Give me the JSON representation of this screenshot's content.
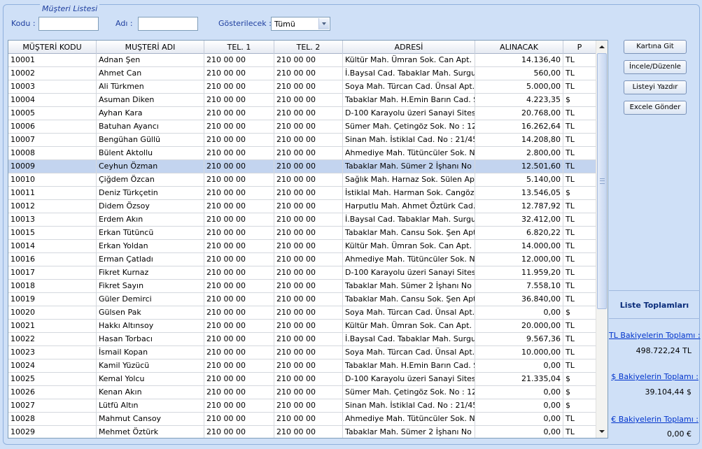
{
  "group_title": "Müşteri Listesi",
  "filters": {
    "code_label": "Kodu :",
    "code_value": "",
    "name_label": "Adı :",
    "name_value": "",
    "show_label": "Gösterilecek :",
    "show_value": "Tümü"
  },
  "columns": [
    "MÜŞTERİ KODU",
    "MUŞTERİ ADI",
    "TEL. 1",
    "TEL. 2",
    "ADRESİ",
    "ALINACAK",
    "P"
  ],
  "selected_row": 8,
  "rows": [
    [
      "10001",
      "Adnan Şen",
      "210 00 00",
      "210 00 00",
      "Kültür Mah. Ümran Sok. Can Apt. No :",
      "14.136,40",
      "TL"
    ],
    [
      "10002",
      "Ahmet Can",
      "210 00 00",
      "210 00 00",
      "İ.Baysal Cad. Tabaklar Mah. Surgulu A",
      "560,00",
      "TL"
    ],
    [
      "10003",
      "Ali Türkmen",
      "210 00 00",
      "210 00 00",
      "Soya Mah. Türcan Cad. Ünsal Apt. No",
      "5.000,00",
      "TL"
    ],
    [
      "10004",
      "Asuman Diken",
      "210 00 00",
      "210 00 00",
      "Tabaklar Mah. H.Emin Barın Cad. Sıla İ",
      "4.223,35",
      "$"
    ],
    [
      "10005",
      "Ayhan Kara",
      "210 00 00",
      "210 00 00",
      "D-100 Karayolu üzeri Sanayi Sitesi D B",
      "20.768,00",
      "TL"
    ],
    [
      "10006",
      "Batuhan Ayancı",
      "210 00 00",
      "210 00 00",
      "Sümer Mah. Çetingöz Sok. No : 125/2!",
      "16.262,64",
      "TL"
    ],
    [
      "10007",
      "Bengühan Güllü",
      "210 00 00",
      "210 00 00",
      "Sinan Mah. İstiklal Cad. No : 21/45 BO",
      "14.208,80",
      "TL"
    ],
    [
      "10008",
      "Bülent Aktollu",
      "210 00 00",
      "210 00 00",
      "Ahmediye Mah. Tütüncüler Sok. No : 1",
      "2.800,00",
      "TL"
    ],
    [
      "10009",
      "Ceyhun Özman",
      "210 00 00",
      "210 00 00",
      "Tabaklar Mah. Sümer 2 İşhanı No : 24/",
      "12.501,60",
      "TL"
    ],
    [
      "10010",
      "Çiğdem Özcan",
      "210 00 00",
      "210 00 00",
      "Sağlık Mah. Harnaz Sok. Sülen Apt. N",
      "5.140,00",
      "TL"
    ],
    [
      "10011",
      "Deniz Türkçetin",
      "210 00 00",
      "210 00 00",
      "İstiklal Mah. Harman Sok. Cangöz Apt.",
      "13.546,05",
      "$"
    ],
    [
      "10012",
      "Didem Özsoy",
      "210 00 00",
      "210 00 00",
      "Harputlu Mah. Ahmet Öztürk Cad. No :",
      "12.787,92",
      "TL"
    ],
    [
      "10013",
      "Erdem Akın",
      "210 00 00",
      "210 00 00",
      "İ.Baysal Cad. Tabaklar Mah. Surgulu A",
      "32.412,00",
      "TL"
    ],
    [
      "10015",
      "Erkan Tütüncü",
      "210 00 00",
      "210 00 00",
      "Tabaklar Mah. Cansu Sok. Şen Apt. N",
      "6.820,22",
      "TL"
    ],
    [
      "10014",
      "Erkan Yoldan",
      "210 00 00",
      "210 00 00",
      "Kültür Mah. Ümran Sok. Can Apt. No :",
      "14.000,00",
      "TL"
    ],
    [
      "10016",
      "Erman Çatladı",
      "210 00 00",
      "210 00 00",
      "Ahmediye Mah. Tütüncüler Sok. No : 1",
      "12.000,00",
      "TL"
    ],
    [
      "10017",
      "Fikret Kurnaz",
      "210 00 00",
      "210 00 00",
      "D-100 Karayolu üzeri Sanayi Sitesi D B",
      "11.959,20",
      "TL"
    ],
    [
      "10018",
      "Fikret Sayın",
      "210 00 00",
      "210 00 00",
      "Tabaklar Mah. Sümer 2 İşhanı No : 24/",
      "7.558,10",
      "TL"
    ],
    [
      "10019",
      "Güler Demirci",
      "210 00 00",
      "210 00 00",
      "Tabaklar Mah. Cansu Sok. Şen Apt. N",
      "36.840,00",
      "TL"
    ],
    [
      "10020",
      "Gülsen Pak",
      "210 00 00",
      "210 00 00",
      "Soya Mah. Türcan Cad. Ünsal Apt. No",
      "0,00",
      "$"
    ],
    [
      "10021",
      "Hakkı Altınsoy",
      "210 00 00",
      "210 00 00",
      "Kültür Mah. Ümran Sok. Can Apt. No :",
      "20.000,00",
      "TL"
    ],
    [
      "10022",
      "Hasan Torbacı",
      "210 00 00",
      "210 00 00",
      "İ.Baysal Cad. Tabaklar Mah. Surgulu A",
      "9.567,36",
      "TL"
    ],
    [
      "10023",
      "İsmail Kopan",
      "210 00 00",
      "210 00 00",
      "Soya Mah. Türcan Cad. Ünsal Apt. No",
      "10.000,00",
      "TL"
    ],
    [
      "10024",
      "Kamil Yüzücü",
      "210 00 00",
      "210 00 00",
      "Tabaklar Mah. H.Emin Barın Cad. Sıla İ",
      "0,00",
      "TL"
    ],
    [
      "10025",
      "Kemal Yolcu",
      "210 00 00",
      "210 00 00",
      "D-100 Karayolu üzeri Sanayi Sitesi D B",
      "21.335,04",
      "$"
    ],
    [
      "10026",
      "Kenan Akın",
      "210 00 00",
      "210 00 00",
      "Sümer Mah. Çetingöz Sok. No : 125/2!",
      "0,00",
      "$"
    ],
    [
      "10027",
      "Lütfü Altın",
      "210 00 00",
      "210 00 00",
      "Sinan Mah. İstiklal Cad. No : 21/45 BO",
      "0,00",
      "$"
    ],
    [
      "10028",
      "Mahmut Cansoy",
      "210 00 00",
      "210 00 00",
      "Ahmediye Mah. Tütüncüler Sok. No : 1",
      "0,00",
      "TL"
    ],
    [
      "10029",
      "Mehmet Öztürk",
      "210 00 00",
      "210 00 00",
      "Tabaklar Mah. Sümer 2 İşhanı No : 24/",
      "0,00",
      "TL"
    ]
  ],
  "buttons": {
    "go_to_card": "Kartına Git",
    "inspect_edit": "İncele/Düzenle",
    "print_list": "Listeyi Yazdır",
    "send_excel": "Excele Gönder"
  },
  "totals": {
    "title": "Liste Toplamları",
    "tl_label": "TL Bakiyelerin Toplamı :",
    "tl_value": "498.722,24 TL",
    "usd_label": "$ Bakiyelerin Toplamı :",
    "usd_value": "39.104,44 $",
    "eur_label": "€ Bakiyelerin Toplamı :",
    "eur_value": "0,00 €"
  }
}
